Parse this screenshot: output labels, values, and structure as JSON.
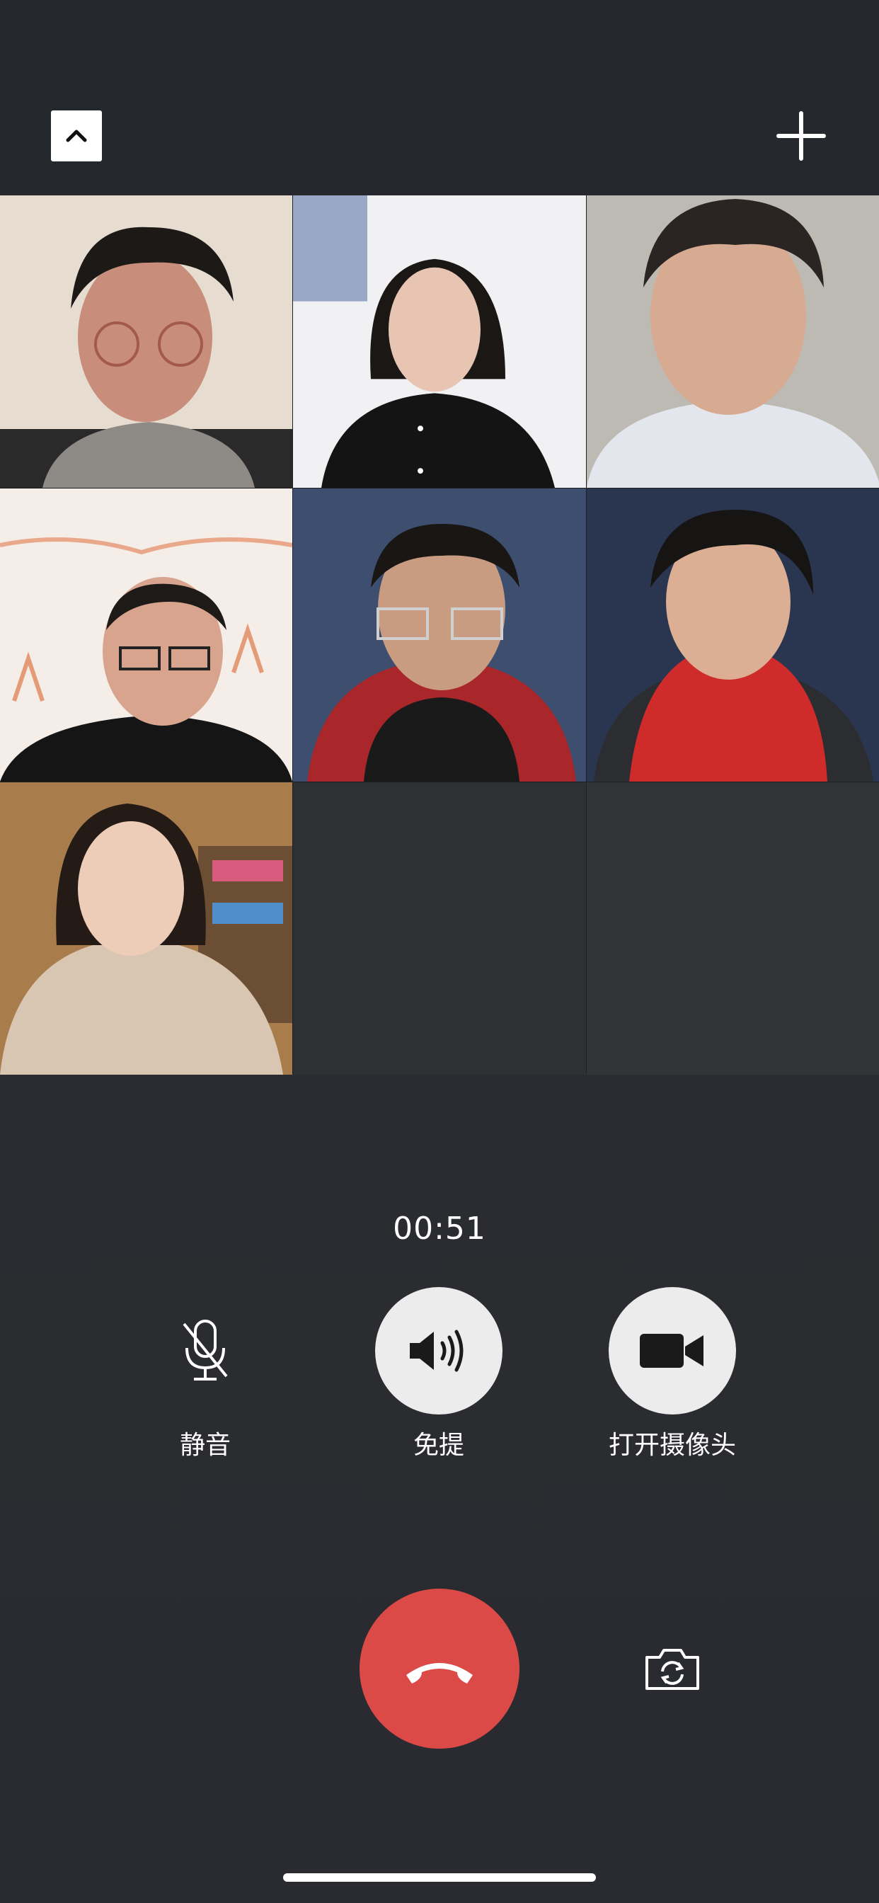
{
  "call": {
    "timer": "00:51"
  },
  "controls": {
    "mute_label": "静音",
    "speaker_label": "免提",
    "camera_label": "打开摄像头"
  },
  "participants": [
    {
      "tile": 1,
      "state": "video"
    },
    {
      "tile": 2,
      "state": "video"
    },
    {
      "tile": 3,
      "state": "video"
    },
    {
      "tile": 4,
      "state": "video"
    },
    {
      "tile": 5,
      "state": "video"
    },
    {
      "tile": 6,
      "state": "video"
    },
    {
      "tile": 7,
      "state": "video"
    }
  ],
  "icons": {
    "collapse": "chevron-up-icon",
    "add": "plus-icon",
    "mute": "microphone-off-icon",
    "speaker": "speaker-icon",
    "camera": "video-camera-icon",
    "hangup": "phone-hangup-icon",
    "switch_camera": "camera-switch-icon"
  },
  "colors": {
    "hangup": "#dc4a48",
    "control_button": "#ececec",
    "background": "#26282d"
  }
}
